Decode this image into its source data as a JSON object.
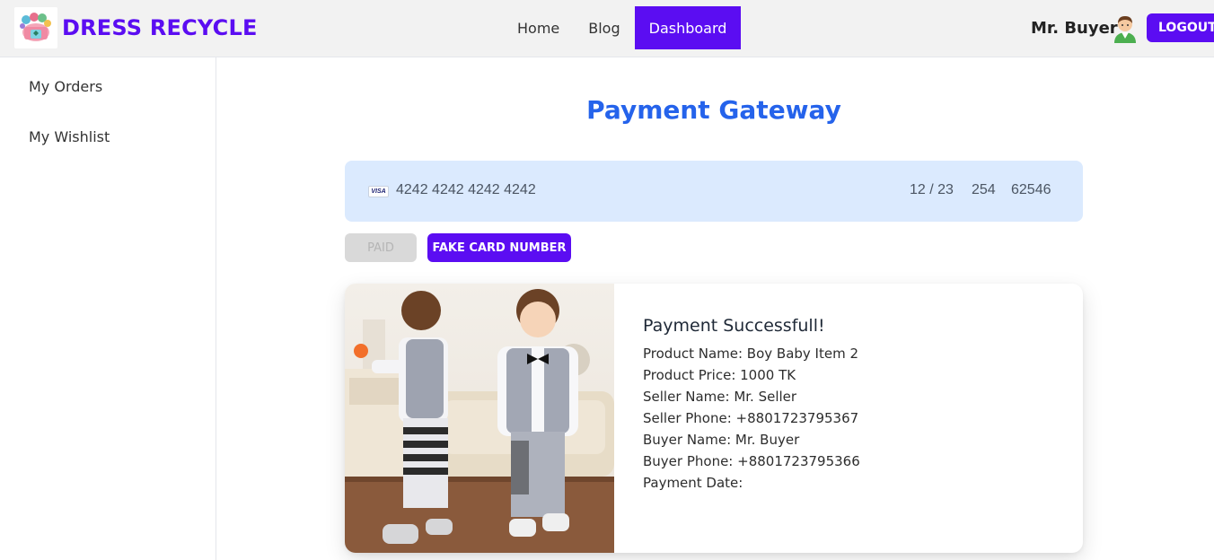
{
  "nav": {
    "brand": "DRESS RECYCLE",
    "links": [
      "Home",
      "Blog",
      "Dashboard"
    ],
    "active": "Dashboard",
    "user_name": "Mr. Buyer",
    "logout_label": "LOGOUT"
  },
  "sidebar": {
    "items": [
      "My Orders",
      "My Wishlist"
    ]
  },
  "payment": {
    "title": "Payment Gateway",
    "card_brand": "VISA",
    "card_number": "4242 4242 4242 4242",
    "expiry": "12 / 23",
    "cvc": "254",
    "zip": "62546",
    "paid_label": "PAID",
    "fake_card_label": "FAKE CARD NUMBER"
  },
  "result": {
    "heading": "Payment Successfull!",
    "product_name": "Product Name: Boy Baby Item 2",
    "product_price": "Product Price: 1000 TK",
    "seller_name": "Seller Name: Mr. Seller",
    "seller_phone": "Seller Phone: +8801723795367",
    "buyer_name": "Buyer Name: Mr. Buyer",
    "buyer_phone": "Buyer Phone: +8801723795366",
    "payment_date": "Payment Date:"
  },
  "colors": {
    "brand": "#5b0df2",
    "title": "#2563eb",
    "card_bg": "#dbeafe"
  }
}
